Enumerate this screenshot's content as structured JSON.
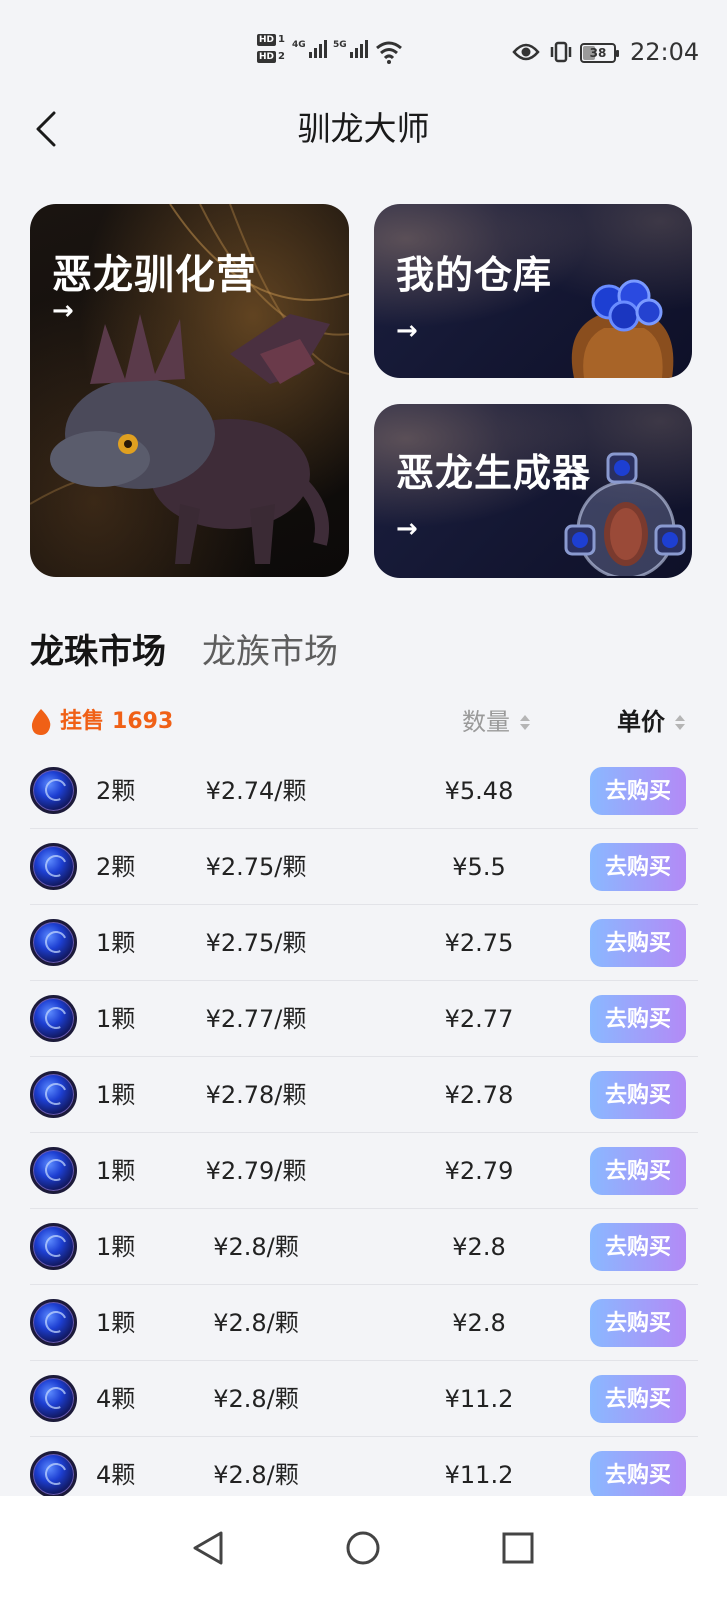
{
  "status_bar": {
    "sim1": "HD",
    "sim1_num": "1",
    "sim2": "HD",
    "sim2_num": "2",
    "net1": "4G",
    "net2": "5G",
    "battery": "38",
    "time": "22:04"
  },
  "header": {
    "title": "驯龙大师",
    "back_icon": "chevron-left-icon"
  },
  "features": [
    {
      "title": "恶龙驯化营",
      "arrow": "→"
    },
    {
      "title": "我的仓库",
      "arrow": "→"
    },
    {
      "title": "恶龙生成器",
      "arrow": "→"
    }
  ],
  "tabs": [
    {
      "label": "龙珠市场",
      "active": true
    },
    {
      "label": "龙族市场",
      "active": false
    }
  ],
  "summary": {
    "listing_label": "挂售",
    "listing_count": "1693",
    "qty_sort_label": "数量",
    "price_sort_label": "单价"
  },
  "colors": {
    "accent_orange": "#f06016",
    "buy_gradient_start": "#8ab8ff",
    "buy_gradient_end": "#b38af6",
    "tab_underline_start": "#6fb6ff",
    "tab_underline_end": "#c48bff"
  },
  "listings": [
    {
      "qty": "2颗",
      "unit_price": "¥2.74/颗",
      "total": "¥5.48",
      "action": "去购买"
    },
    {
      "qty": "2颗",
      "unit_price": "¥2.75/颗",
      "total": "¥5.5",
      "action": "去购买"
    },
    {
      "qty": "1颗",
      "unit_price": "¥2.75/颗",
      "total": "¥2.75",
      "action": "去购买"
    },
    {
      "qty": "1颗",
      "unit_price": "¥2.77/颗",
      "total": "¥2.77",
      "action": "去购买"
    },
    {
      "qty": "1颗",
      "unit_price": "¥2.78/颗",
      "total": "¥2.78",
      "action": "去购买"
    },
    {
      "qty": "1颗",
      "unit_price": "¥2.79/颗",
      "total": "¥2.79",
      "action": "去购买"
    },
    {
      "qty": "1颗",
      "unit_price": "¥2.8/颗",
      "total": "¥2.8",
      "action": "去购买"
    },
    {
      "qty": "1颗",
      "unit_price": "¥2.8/颗",
      "total": "¥2.8",
      "action": "去购买"
    },
    {
      "qty": "4颗",
      "unit_price": "¥2.8/颗",
      "total": "¥11.2",
      "action": "去购买"
    },
    {
      "qty": "4颗",
      "unit_price": "¥2.8/颗",
      "total": "¥11.2",
      "action": "去购买"
    }
  ],
  "nav_bar": {
    "back": "triangle-back-icon",
    "home": "circle-home-icon",
    "recents": "square-recents-icon"
  }
}
